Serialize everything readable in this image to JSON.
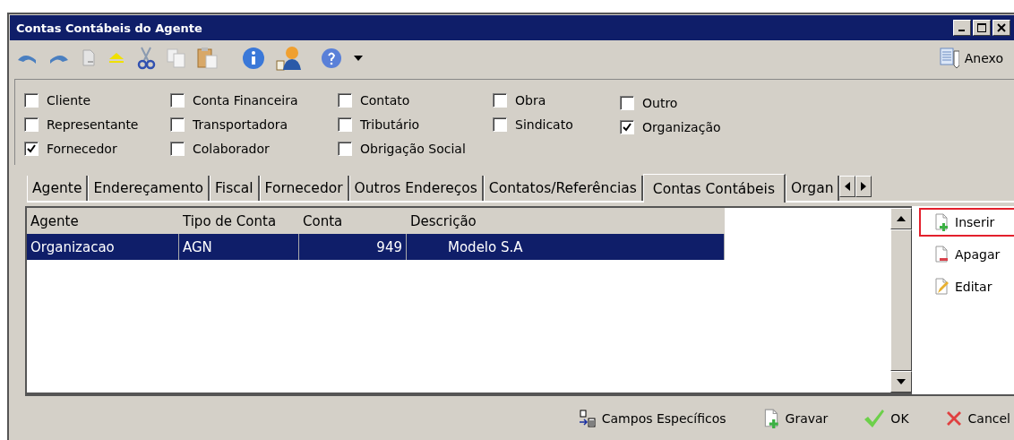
{
  "window": {
    "title": "Contas Contábeis do Agente"
  },
  "toolbar": {
    "right_button": "Anexo"
  },
  "checkbox_columns": [
    [
      {
        "label": "Cliente",
        "checked": false
      },
      {
        "label": "Representante",
        "checked": false
      },
      {
        "label": "Fornecedor",
        "checked": true
      }
    ],
    [
      {
        "label": "Conta Financeira",
        "checked": false
      },
      {
        "label": "Transportadora",
        "checked": false
      },
      {
        "label": "Colaborador",
        "checked": false
      }
    ],
    [
      {
        "label": "Contato",
        "checked": false
      },
      {
        "label": "Tributário",
        "checked": false
      },
      {
        "label": "Obrigação Social",
        "checked": false
      }
    ],
    [
      {
        "label": "Obra",
        "checked": false
      },
      {
        "label": "Sindicato",
        "checked": false
      }
    ],
    [
      {
        "label": "Outro",
        "checked": false
      },
      {
        "label": "Organização",
        "checked": true
      }
    ]
  ],
  "tabs": [
    {
      "label": "Agente",
      "selected": false
    },
    {
      "label": "Endereçamento",
      "selected": false
    },
    {
      "label": "Fiscal",
      "selected": false
    },
    {
      "label": "Fornecedor",
      "selected": false
    },
    {
      "label": "Outros Endereços",
      "selected": false
    },
    {
      "label": "Contatos/Referências",
      "selected": false
    },
    {
      "label": "Contas Contábeis",
      "selected": true
    },
    {
      "label": "Organ",
      "selected": false
    }
  ],
  "table": {
    "columns": [
      "Agente",
      "Tipo de Conta",
      "Conta",
      "Descrição"
    ],
    "rows": [
      {
        "cells": [
          "Organizacao",
          "AGN",
          "949",
          "Modelo S.A"
        ],
        "selected": true
      }
    ]
  },
  "side_buttons": [
    {
      "kind": "insert",
      "label": "Inserir",
      "highlighted": true
    },
    {
      "kind": "delete",
      "label": "Apagar",
      "highlighted": false
    },
    {
      "kind": "edit",
      "label": "Editar",
      "highlighted": false
    }
  ],
  "footer_buttons": [
    {
      "kind": "fields",
      "label": "Campos Específicos"
    },
    {
      "kind": "save",
      "label": "Gravar"
    },
    {
      "kind": "ok",
      "label": "OK"
    },
    {
      "kind": "cancel",
      "label": "Cancel"
    }
  ]
}
